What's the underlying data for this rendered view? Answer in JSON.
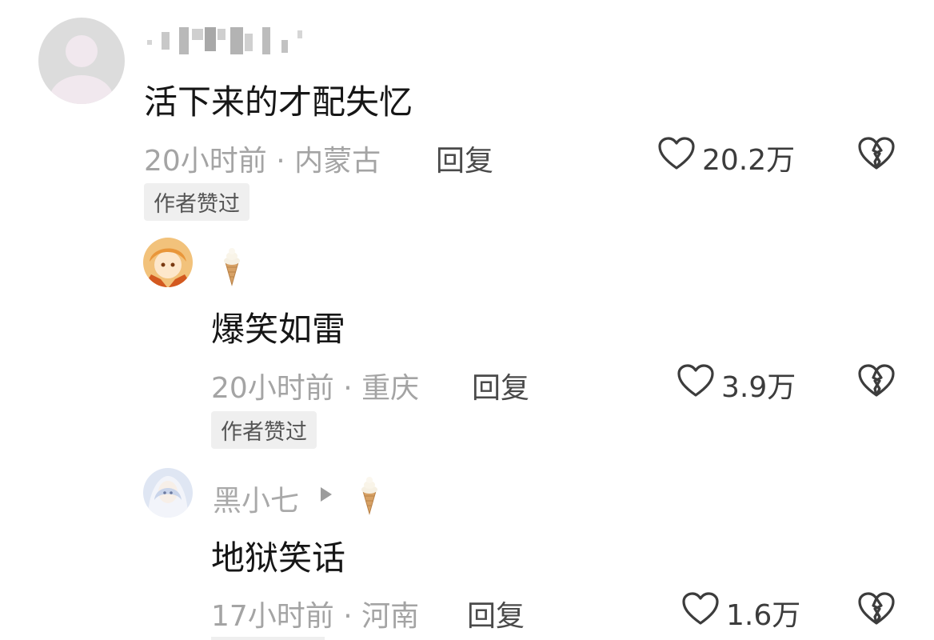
{
  "comments": [
    {
      "username": "",
      "text": "活下来的才配失忆",
      "time_location": "20小时前 · 内蒙古",
      "reply_label": "回复",
      "likes": "20.2万",
      "badge": "作者赞过"
    },
    {
      "username": "",
      "text": "爆笑如雷",
      "time_location": "20小时前 · 重庆",
      "reply_label": "回复",
      "likes": "3.9万",
      "badge": "作者赞过"
    },
    {
      "username": "黑小七",
      "text": "地狱笑话",
      "time_location": "17小时前 · 河南",
      "reply_label": "回复",
      "likes": "1.6万"
    }
  ],
  "icons": {
    "like": "heart-outline-icon",
    "dislike": "broken-heart-icon",
    "username_badge": "ice-cream-icon",
    "arrow": "triangle-right-icon"
  }
}
